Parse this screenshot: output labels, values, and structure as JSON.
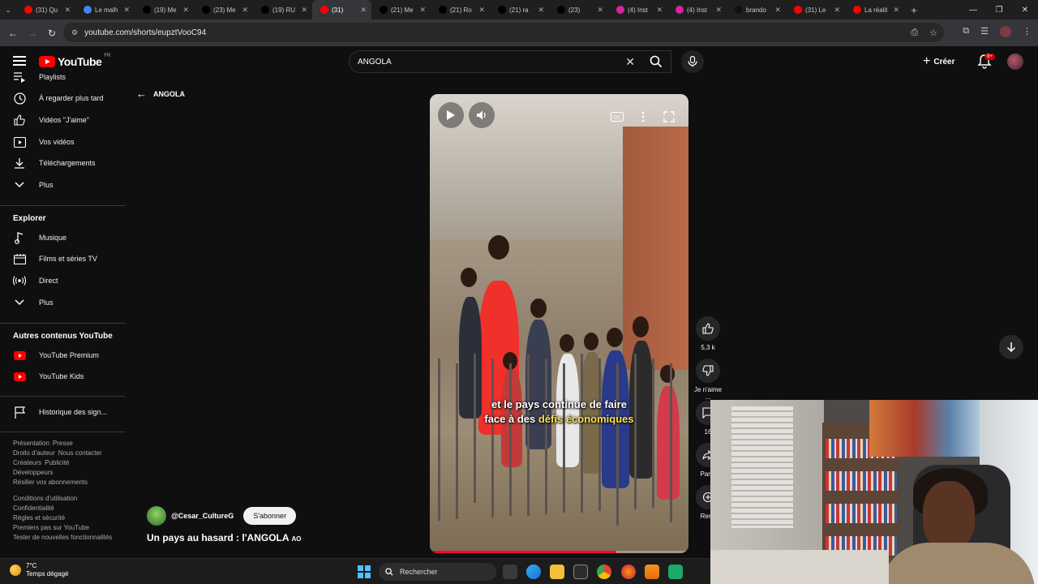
{
  "browser": {
    "tabs": [
      {
        "title": "(31) Qu",
        "favicon": "youtube-icon",
        "color": "#ff0000"
      },
      {
        "title": "Le malh",
        "favicon": "google-icon",
        "color": "#4285f4"
      },
      {
        "title": "(19) Me",
        "favicon": "x-icon",
        "color": "#000000"
      },
      {
        "title": "(23) Me",
        "favicon": "x-icon",
        "color": "#000000"
      },
      {
        "title": "(19) RU",
        "favicon": "x-icon",
        "color": "#000000"
      },
      {
        "title": "(31)",
        "favicon": "youtube-icon",
        "color": "#ff0000",
        "active": true
      },
      {
        "title": "(21) Me",
        "favicon": "x-icon",
        "color": "#000000"
      },
      {
        "title": "(21) Ro",
        "favicon": "x-icon",
        "color": "#000000"
      },
      {
        "title": "(21) ra",
        "favicon": "x-icon",
        "color": "#000000"
      },
      {
        "title": "(23)",
        "favicon": "x-icon",
        "color": "#000000"
      },
      {
        "title": "(4) Inst",
        "favicon": "instagram-icon",
        "color": "#d6249f"
      },
      {
        "title": "(4) Inst",
        "favicon": "instagram-icon",
        "color": "#d6249f"
      },
      {
        "title": "brando",
        "favicon": "tiktok-icon",
        "color": "#111111"
      },
      {
        "title": "(31) Le",
        "favicon": "youtube-icon",
        "color": "#ff0000"
      },
      {
        "title": "La réalit",
        "favicon": "youtube-icon",
        "color": "#ff0000"
      }
    ],
    "url": "youtube.com/shorts/eupztVooC94"
  },
  "youtube": {
    "logo_text": "YouTube",
    "region": "FR",
    "search_value": "ANGOLA",
    "create_label": "Créer",
    "notif_count": "9+"
  },
  "sidebar": {
    "items_top": [
      {
        "label": "Playlists",
        "icon": "playlist-icon"
      },
      {
        "label": "À regarder plus tard",
        "icon": "clock-icon"
      },
      {
        "label": "Vidéos \"J'aime\"",
        "icon": "thumbs-up-icon"
      },
      {
        "label": "Vos vidéos",
        "icon": "play-square-icon"
      },
      {
        "label": "Téléchargements",
        "icon": "download-icon"
      },
      {
        "label": "Plus",
        "icon": "chevron-down-icon"
      }
    ],
    "explore_title": "Explorer",
    "explore_items": [
      {
        "label": "Musique",
        "icon": "music-icon"
      },
      {
        "label": "Films et séries TV",
        "icon": "film-icon"
      },
      {
        "label": "Direct",
        "icon": "live-icon"
      },
      {
        "label": "Plus",
        "icon": "chevron-down-icon"
      }
    ],
    "more_title": "Autres contenus YouTube",
    "more_items": [
      {
        "label": "YouTube Premium",
        "icon": "youtube-premium-icon"
      },
      {
        "label": "YouTube Kids",
        "icon": "youtube-kids-icon"
      }
    ],
    "report_item": {
      "label": "Historique des sign...",
      "icon": "flag-icon"
    },
    "footer_links_1": [
      "Présentation",
      "Presse",
      "Droits d'auteur",
      "Nous contacter",
      "Créateurs",
      "Publicité",
      "Développeurs",
      "Résilier vos abonnements"
    ],
    "footer_links_2": [
      "Conditions d'utilisation",
      "Confidentialité",
      "Règles et sécurité",
      "Premiers pas sur YouTube",
      "Tester de nouvelles fonctionnalités"
    ]
  },
  "short": {
    "back_label": "ANGOLA",
    "caption_line1": "et le pays continue de faire",
    "caption_line2_prefix": "face à des ",
    "caption_line2_highlight": "défis économiques",
    "progress": 0.72,
    "channel": "@Cesar_CultureG",
    "subscribe_label": "S'abonner",
    "title": "Un pays au hasard : l'ANGOLA",
    "title_flag": "AO",
    "likes": "5,3 k",
    "dislike_label": "Je n'aime ...",
    "comments": "16",
    "share_label": "Parta",
    "remix_label": "Remi"
  },
  "taskbar": {
    "temperature": "7°C",
    "weather": "Temps dégagé",
    "search_label": "Rechercher"
  }
}
